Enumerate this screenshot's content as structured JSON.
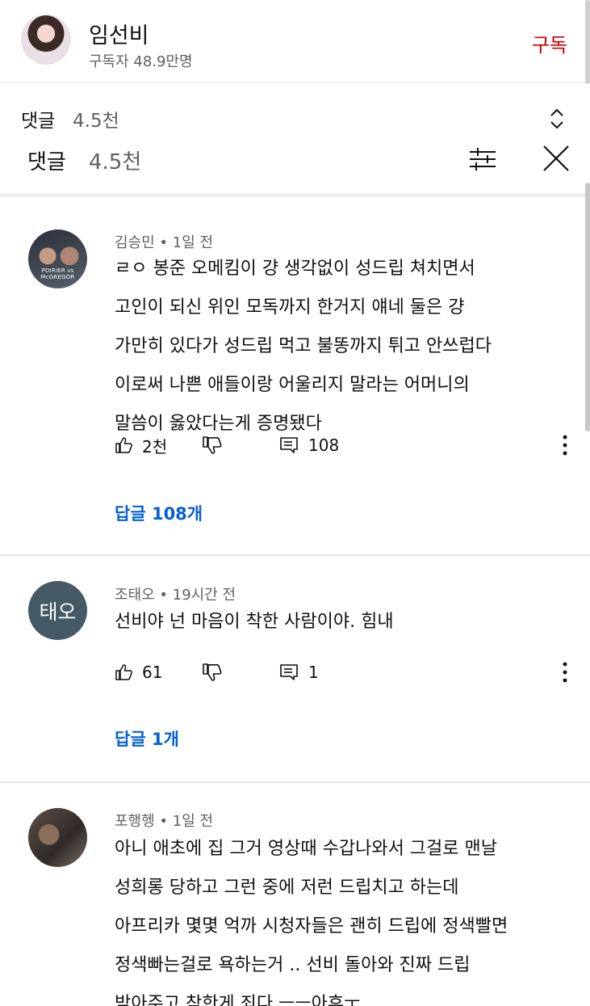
{
  "channel": {
    "name": "임선비",
    "subscribers": "구독자 48.9만명",
    "subscribe_label": "구독"
  },
  "sticky": {
    "label": "댓글",
    "count": "4.5천"
  },
  "comments_header": {
    "label": "댓글",
    "count": "4.5천"
  },
  "comments": [
    {
      "author": "김승민",
      "time": "1일 전",
      "meta": "김승민 • 1일 전",
      "avatar_text": "POIRIER vs McGREGOR",
      "text": "ㄹㅇ 봉준 오메킴이 걍 생각없이 성드립 쳐치면서\n고인이 되신 위인 모독까지 한거지 얘네 둘은 걍\n가만히 있다가 성드립 먹고 불똥까지 튀고 안쓰럽다\n이로써 나쁜 애들이랑 어울리지 말라는 어머니의\n말씀이 옳았다는게 증명됐다",
      "likes": "2천",
      "replies": "108",
      "replies_link": "답글 108개"
    },
    {
      "author": "조태오",
      "time": "19시간 전",
      "meta": "조태오 • 19시간 전",
      "avatar_text": "태오",
      "text": "선비야 넌 마음이 착한 사람이야. 힘내",
      "likes": "61",
      "replies": "1",
      "replies_link": "답글 1개"
    },
    {
      "author": "포행헹",
      "time": "1일 전",
      "meta": "포행헹 • 1일 전",
      "text": "아니 애초에 집 그거 영상때 수갑나와서 그걸로 맨날\n성희롱 당하고 그런 중에 저런 드립치고 하는데\n아프리카 몇몇 억까 시청자들은 괜히 드립에 정색빨면\n정색빠는걸로 욕하는거 .. 선비 돌아와 진짜 드립\n받아주고 착한게 죄다 ㅡㅡ아후ㅜ"
    }
  ],
  "colors": {
    "subscribe": "#cc0000",
    "link": "#065fd4",
    "avatar_initial_bg": "#455a64"
  },
  "icons": [
    "expand-icon",
    "sort-icon",
    "close-icon",
    "thumbs-up-icon",
    "thumbs-down-icon",
    "reply-icon",
    "more-vert-icon"
  ]
}
